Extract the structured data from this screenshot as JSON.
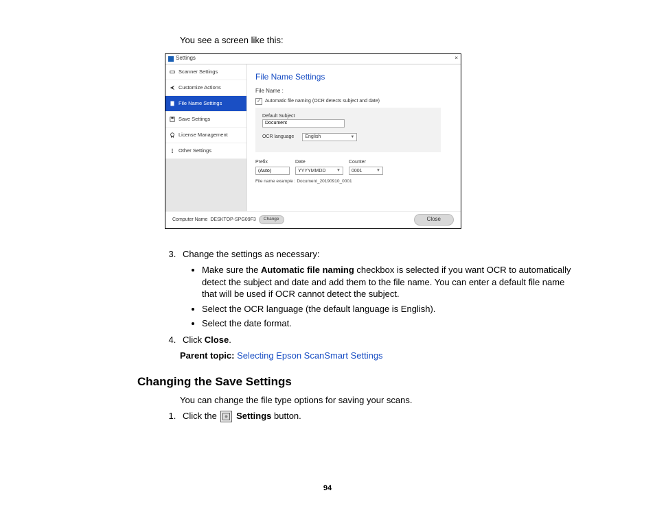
{
  "intro": "You see a screen like this:",
  "shot": {
    "window_title": "Settings",
    "close_x": "×",
    "sidebar": [
      {
        "label": "Scanner Settings"
      },
      {
        "label": "Customize Actions"
      },
      {
        "label": "File Name Settings"
      },
      {
        "label": "Save Settings"
      },
      {
        "label": "License Management"
      },
      {
        "label": "Other Settings"
      }
    ],
    "heading": "File Name Settings",
    "filename_label": "File Name :",
    "auto_checkbox_label": "Automatic file naming (OCR detects subject and date)",
    "default_subject_label": "Default Subject",
    "default_subject_value": "Document",
    "ocr_lang_label": "OCR language",
    "ocr_lang_value": "English",
    "prefix_label": "Prefix",
    "prefix_value": "(Auto)",
    "date_label": "Date",
    "date_value": "YYYYMMDD",
    "counter_label": "Counter",
    "counter_value": "0001",
    "example_label": "File name example : Document_20190910_0001",
    "footer_computer_label": "Computer Name",
    "footer_computer_value": "DESKTOP-SPG09F3",
    "footer_change": "Change",
    "footer_close": "Close"
  },
  "step3_lead": "Change the settings as necessary:",
  "step3_b1_a": "Make sure the ",
  "step3_b1_bold": "Automatic file naming",
  "step3_b1_b": " checkbox is selected if you want OCR to automatically detect the subject and date and add them to the file name. You can enter a default file name that will be used if OCR cannot detect the subject.",
  "step3_b2": "Select the OCR language (the default language is English).",
  "step3_b3": "Select the date format.",
  "step4_a": "Click ",
  "step4_bold": "Close",
  "step4_b": ".",
  "parent_topic_label": "Parent topic:",
  "parent_topic_link": "Selecting Epson ScanSmart Settings",
  "section_heading": "Changing the Save Settings",
  "section_body": "You can change the file type options for saving your scans.",
  "steps2_1_a": "Click the",
  "steps2_1_bold": "Settings",
  "steps2_1_b": " button.",
  "page_number": "94"
}
